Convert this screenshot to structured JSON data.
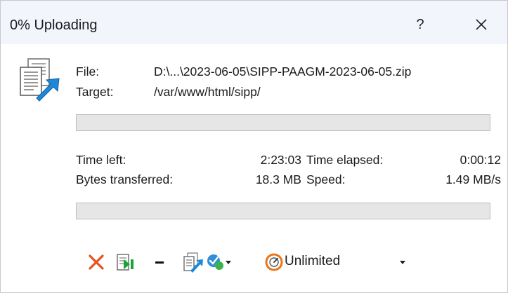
{
  "window": {
    "title": "0% Uploading",
    "help_glyph": "?",
    "close_icon": "close-icon"
  },
  "transfer": {
    "file_label": "File:",
    "file_value": "D:\\...\\2023-06-05\\SIPP-PAAGM-2023-06-05.zip",
    "target_label": "Target:",
    "target_value": "/var/www/html/sipp/",
    "file_progress": 0
  },
  "stats": {
    "time_left_label": "Time left:",
    "time_left_value": "2:23:03",
    "time_elapsed_label": "Time elapsed:",
    "time_elapsed_value": "0:00:12",
    "bytes_label": "Bytes transferred:",
    "bytes_value": "18.3 MB",
    "speed_label": "Speed:",
    "speed_value": "1.49 MB/s",
    "overall_progress": 0
  },
  "toolbar": {
    "cancel_icon": "cancel-icon",
    "background_icon": "background-transfer-icon",
    "minimize_icon": "minimize-icon",
    "queue_icon": "queue-icon",
    "once_finished_icon": "once-finished-icon",
    "speed_icon": "speed-limit-icon",
    "speed_limit": "Unlimited"
  },
  "colors": {
    "titlebar": "#f2f5fb",
    "progress_track": "#e6e6e6",
    "cancel": "#e8501c",
    "accent_blue": "#1e88d8"
  }
}
